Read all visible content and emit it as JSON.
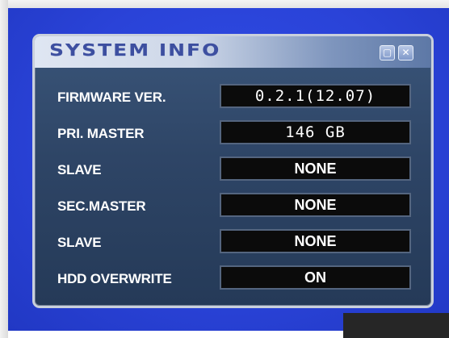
{
  "window": {
    "title": "SYSTEM INFO",
    "restore_icon": "restore-icon",
    "close_icon": "close-icon",
    "restore_glyph": "▢",
    "close_glyph": "✕"
  },
  "rows": [
    {
      "label": "FIRMWARE VER.",
      "value": "0.2.1(12.07)"
    },
    {
      "label": "PRI. MASTER",
      "value": "146 GB"
    },
    {
      "label": "SLAVE",
      "value": "NONE"
    },
    {
      "label": "SEC.MASTER",
      "value": "NONE"
    },
    {
      "label": "SLAVE",
      "value": "NONE"
    },
    {
      "label": "HDD OVERWRITE",
      "value": "ON"
    }
  ],
  "colors": {
    "screen_blue": "#2a43d8",
    "panel_bg": "#2e4566",
    "value_bg": "#0b0b0b",
    "title_text": "#3d4fa0"
  }
}
